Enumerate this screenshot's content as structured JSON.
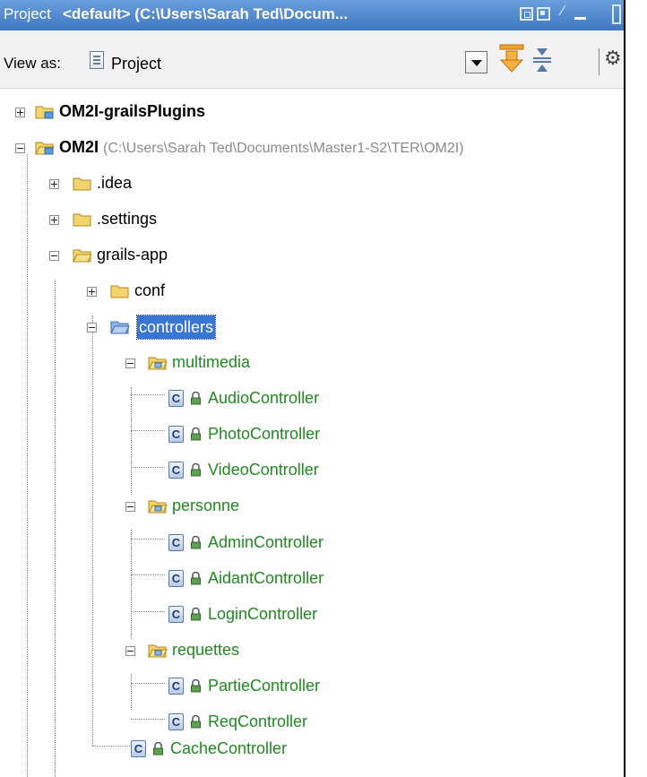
{
  "header": {
    "title_left": "Project",
    "title_main": "<default> (C:\\Users\\Sarah Ted\\Docum..."
  },
  "toolbar": {
    "view_as_label": "View as:",
    "view_as_value": "Project"
  },
  "tree": {
    "plugins_label": "OM2I-grailsPlugins",
    "root_label": "OM2I",
    "root_path": "(C:\\Users\\Sarah Ted\\Documents\\Master1-S2\\TER\\OM2I)",
    "idea_label": ".idea",
    "settings_label": ".settings",
    "grailsapp_label": "grails-app",
    "conf_label": "conf",
    "controllers_label": "controllers",
    "multimedia_label": "multimedia",
    "audio_label": "AudioController",
    "photo_label": "PhotoController",
    "video_label": "VideoController",
    "personne_label": "personne",
    "admin_label": "AdminController",
    "aidant_label": "AidantController",
    "login_label": "LoginController",
    "requettes_label": "requettes",
    "partie_label": "PartieController",
    "req_label": "ReqController",
    "cache_label": "CacheController",
    "class_glyph": "C"
  },
  "colors": {
    "titlebar": "#4a83cc",
    "selection": "#3875d7",
    "class_name_green": "#1f8a1f",
    "folder_yellow": "#f3d36b",
    "package_folder_blue": "#8fb3e6"
  }
}
